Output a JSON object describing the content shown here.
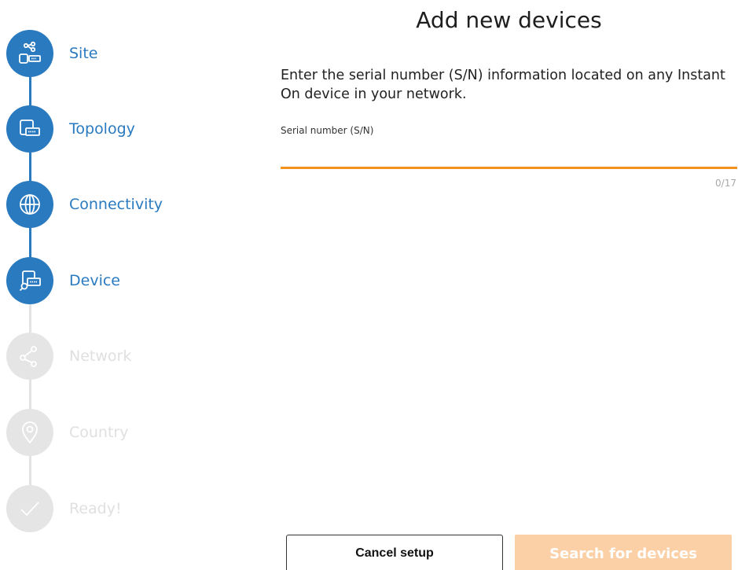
{
  "stepper": {
    "steps": [
      {
        "label": "Site",
        "icon": "site-devices-icon",
        "state": "done"
      },
      {
        "label": "Topology",
        "icon": "topology-icon",
        "state": "done"
      },
      {
        "label": "Connectivity",
        "icon": "globe-icon",
        "state": "done"
      },
      {
        "label": "Device",
        "icon": "device-search-icon",
        "state": "current"
      },
      {
        "label": "Network",
        "icon": "network-share-icon",
        "state": "todo"
      },
      {
        "label": "Country",
        "icon": "location-pin-icon",
        "state": "todo"
      },
      {
        "label": "Ready!",
        "icon": "checkmark-icon",
        "state": "todo"
      }
    ],
    "colors": {
      "active": "#2a7ac0",
      "inactive": "#e5e5e5"
    }
  },
  "main": {
    "title": "Add new devices",
    "instructions": "Enter the serial number (S/N) information located on any Instant On device in your network.",
    "serial": {
      "label": "Serial number (S/N)",
      "value": "",
      "placeholder": "",
      "counter": "0/17",
      "accent_color": "#f5921e"
    }
  },
  "actions": {
    "cancel_label": "Cancel setup",
    "search_label": "Search for devices",
    "search_color": "#fcd0a6"
  }
}
